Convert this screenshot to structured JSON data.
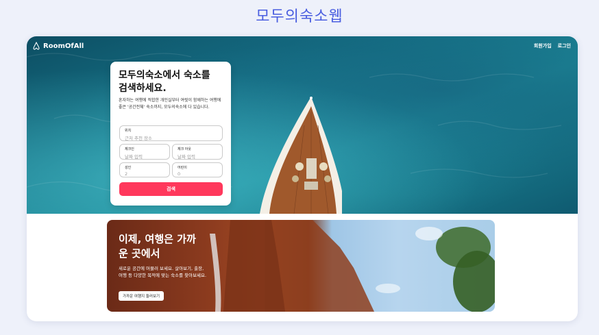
{
  "page_heading": "모두의숙소웹",
  "header": {
    "logo_text": "RoomOfAll",
    "signup_label": "회원가입",
    "login_label": "로그인"
  },
  "search": {
    "title": "모두의숙소에서 숙소를 검색하세요.",
    "description": "혼자하는 여행에 적합한 개인실부터 여럿이 함께하는 여행에 좋은 '공간전체' 숙소까지, 모두의숙소에 다 있습니다.",
    "location_label": "위치",
    "location_placeholder": "근처 추천 장소",
    "checkin_label": "체크인",
    "checkin_placeholder": "날짜 입력",
    "checkout_label": "체크 아웃",
    "checkout_placeholder": "날짜 입력",
    "adults_label": "성인",
    "adults_value": "2",
    "children_label": "어린이",
    "children_value": "0",
    "button_label": "검색"
  },
  "banner": {
    "title": "이제, 여행은 가까운 곳에서",
    "description": "새로운 공간에 머물러 보세요. 살아보기, 출장, 여행 등 다양한 목적에 맞는 숙소를 찾아보세요.",
    "button_label": "가까운 여행지 둘러보기"
  },
  "icons": {
    "logo": "airbnb-logo-icon"
  },
  "colors": {
    "accent": "#ff385c",
    "heading": "#4a5ee0"
  }
}
